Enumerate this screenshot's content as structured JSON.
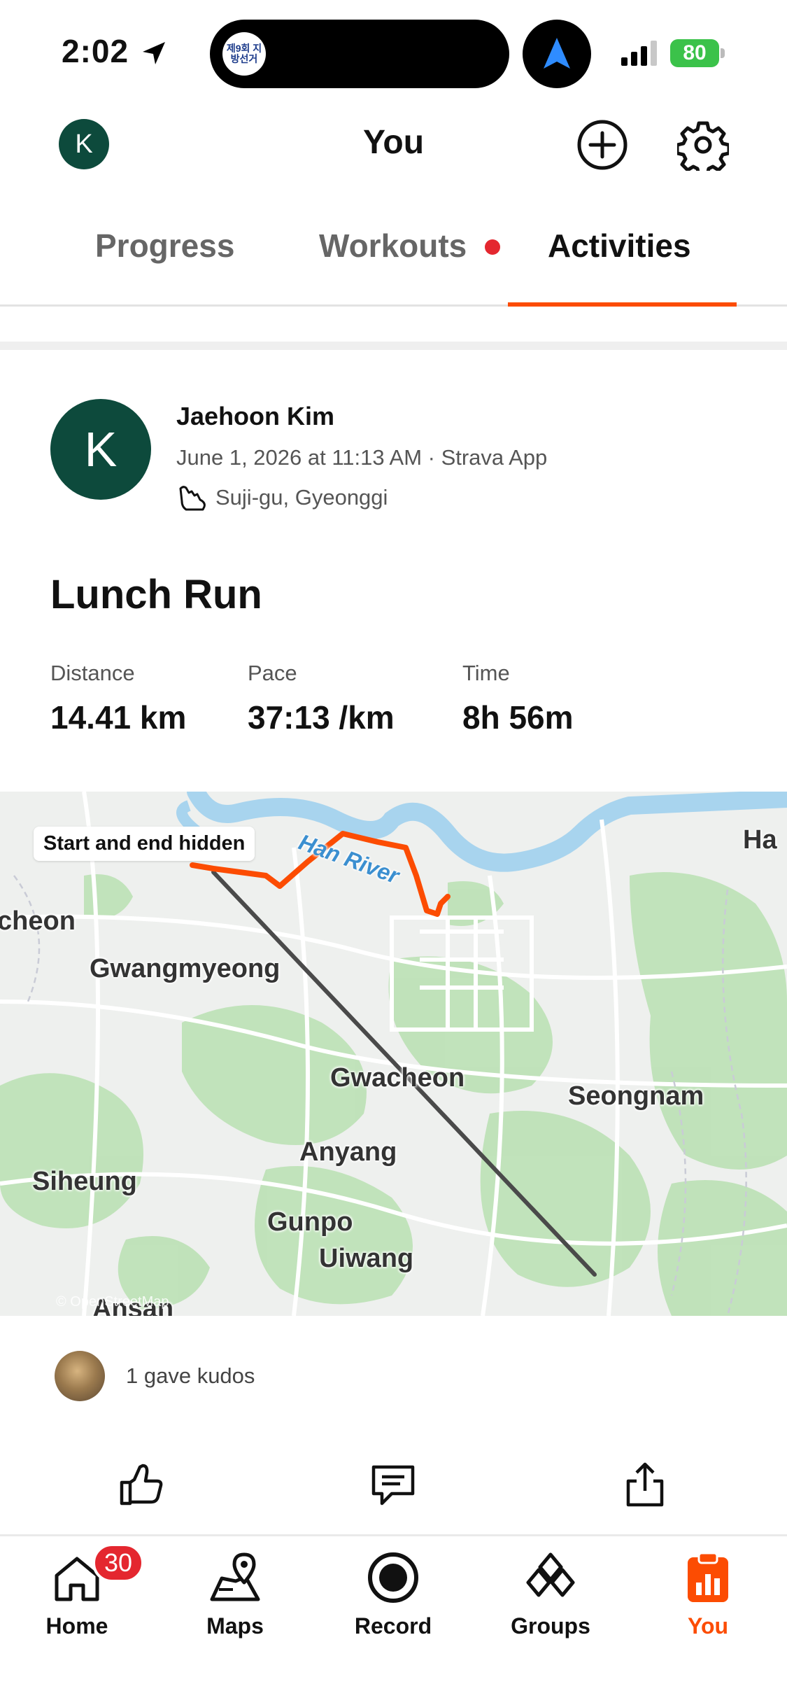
{
  "status_bar": {
    "time": "2:02",
    "island_badge": "제9회 지방선거",
    "battery": "80"
  },
  "header": {
    "avatar_initial": "K",
    "title": "You"
  },
  "tabs": [
    {
      "label": "Progress",
      "active": false
    },
    {
      "label": "Workouts",
      "active": false,
      "has_dot": true
    },
    {
      "label": "Activities",
      "active": true
    }
  ],
  "activity": {
    "athlete_initial": "K",
    "athlete_name": "Jaehoon Kim",
    "meta": "June 1, 2026 at 11:13 AM · Strava App",
    "location": "Suji-gu, Gyeonggi",
    "title": "Lunch Run",
    "stats": [
      {
        "label": "Distance",
        "value": "14.41 km"
      },
      {
        "label": "Pace",
        "value": "37:13 /km"
      },
      {
        "label": "Time",
        "value": "8h 56m"
      }
    ]
  },
  "map": {
    "privacy_label": "Start and end hidden",
    "place_labels": [
      "cheon",
      "Gwangmyeong",
      "Gwacheon",
      "Seongnam",
      "Anyang",
      "Siheung",
      "Gunpo",
      "Uiwang",
      "Ansan",
      "Ha"
    ],
    "river_label": "Han River",
    "attribution": "© OpenStreetMap",
    "route_color": "#fc4c02"
  },
  "kudos": {
    "text": "1 gave kudos"
  },
  "actions": {
    "kudos_icon": "thumbs-up-icon",
    "comment_icon": "comment-icon",
    "share_icon": "share-icon"
  },
  "bottom_nav": {
    "home": "Home",
    "home_badge": "30",
    "maps": "Maps",
    "record": "Record",
    "groups": "Groups",
    "you": "You"
  },
  "colors": {
    "accent": "#fc4c02",
    "avatar_bg": "#0d4a3c",
    "badge_red": "#e4272f"
  }
}
